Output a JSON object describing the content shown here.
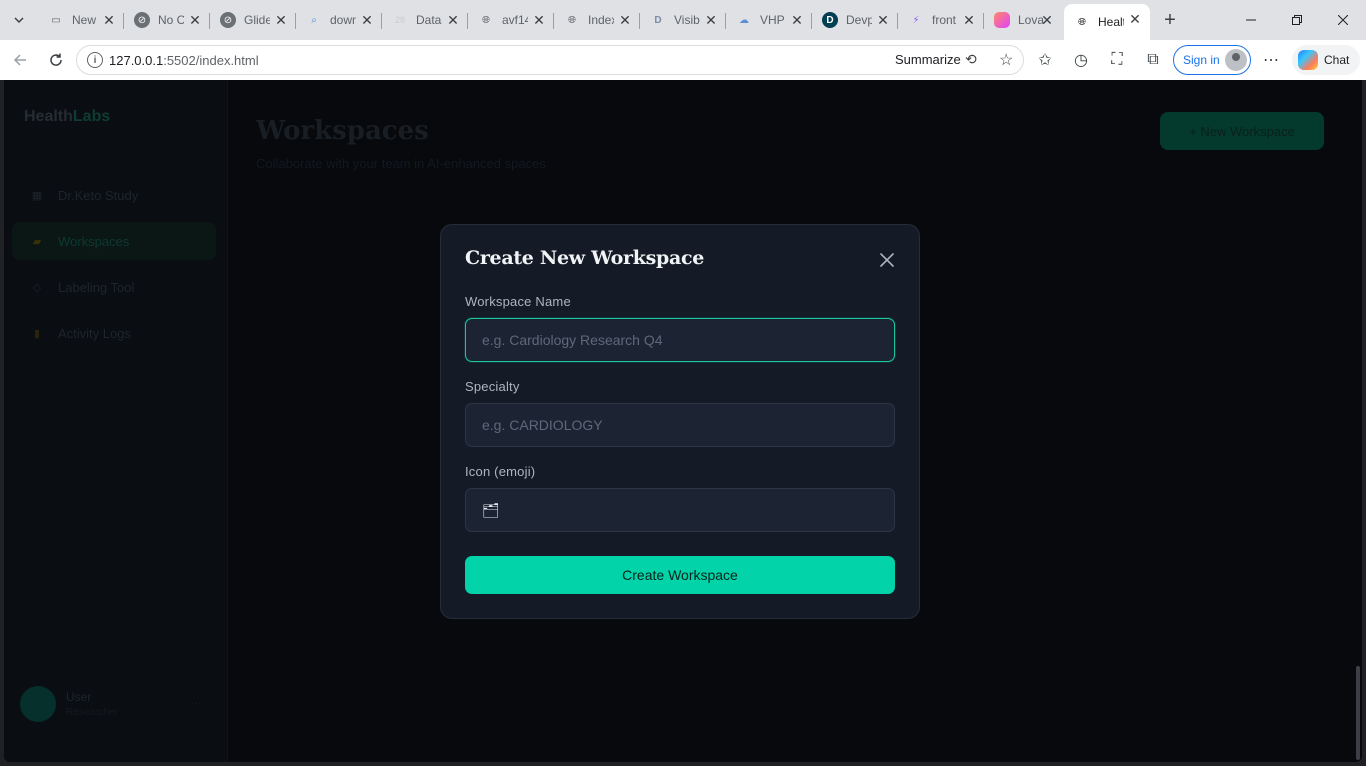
{
  "browser": {
    "tabs": [
      {
        "title": "New",
        "icon": "page-icon"
      },
      {
        "title": "No C",
        "icon": "compass-icon"
      },
      {
        "title": "Glide",
        "icon": "compass-icon"
      },
      {
        "title": "down",
        "icon": "search-icon"
      },
      {
        "title": "Datas",
        "icon": "dataset-icon"
      },
      {
        "title": "avf14",
        "icon": "globe-icon"
      },
      {
        "title": "Index",
        "icon": "globe-icon"
      },
      {
        "title": "Visibl",
        "icon": "d-logo-icon"
      },
      {
        "title": "VHP",
        "icon": "cloud-icon"
      },
      {
        "title": "Devp",
        "icon": "devpost-icon"
      },
      {
        "title": "front",
        "icon": "bolt-icon"
      },
      {
        "title": "Lovab",
        "icon": "heart-icon"
      },
      {
        "title": "Healt",
        "icon": "globe-icon"
      }
    ],
    "url_host": "127.0.0.1",
    "url_rest": ":5502/index.html",
    "summarize_label": "Summarize",
    "signin_label": "Sign in",
    "chat_label": "Chat"
  },
  "app": {
    "logo_main": "Health",
    "logo_accent": "Labs",
    "nav": [
      {
        "label": "Dr.Keto Study",
        "icon": "grid-icon"
      },
      {
        "label": "Workspaces",
        "icon": "folder-icon"
      },
      {
        "label": "Labeling Tool",
        "icon": "tag-icon"
      },
      {
        "label": "Activity Logs",
        "icon": "clipboard-icon"
      }
    ],
    "page_title": "Workspaces",
    "page_subtitle": "Collaborate with your team in AI-enhanced spaces",
    "new_button": "+ New Workspace",
    "user_name": "User",
    "user_sub": "Researcher"
  },
  "modal": {
    "title": "Create New Workspace",
    "name_label": "Workspace Name",
    "name_placeholder": "e.g. Cardiology Research Q4",
    "specialty_label": "Specialty",
    "specialty_placeholder": "e.g. CARDIOLOGY",
    "icon_label": "Icon (emoji)",
    "icon_value": "🗂",
    "submit_label": "Create Workspace"
  },
  "colors": {
    "accent": "#02d3a8",
    "modal_bg": "#151b26",
    "input_bg": "#1c2433"
  }
}
